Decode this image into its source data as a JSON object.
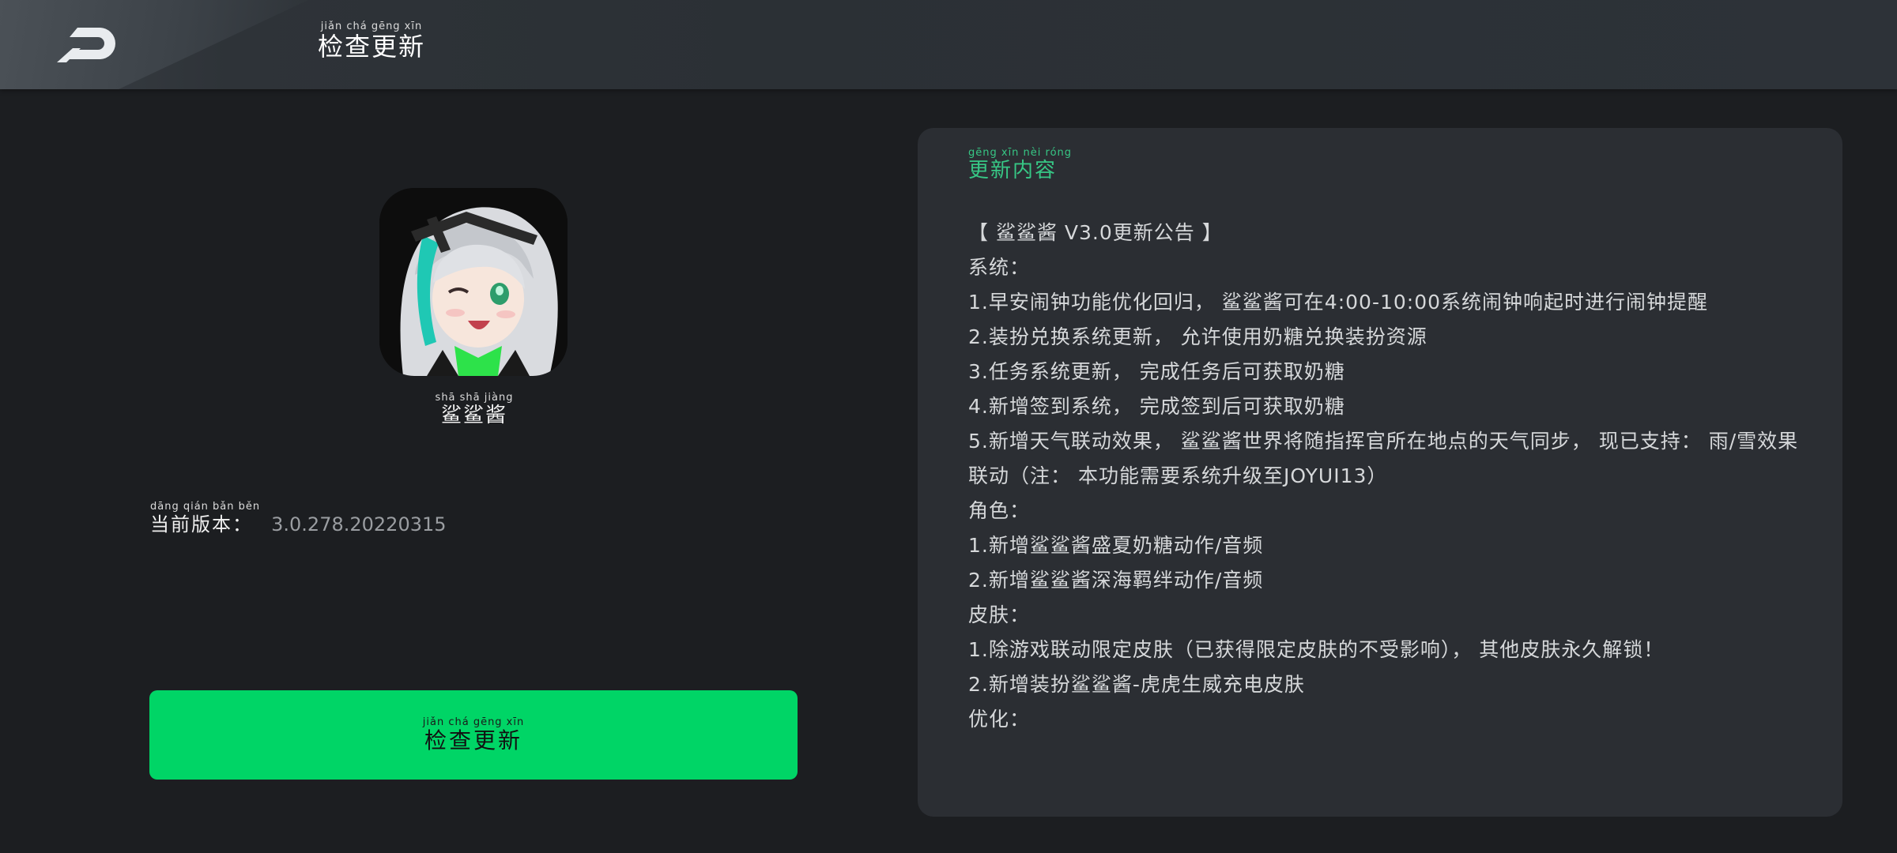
{
  "header": {
    "title_pinyin": "jiǎn chá gēng xīn",
    "title": "检查更新",
    "back_icon": "back-arrow-icon"
  },
  "app": {
    "name_pinyin": "shā shā jiàng",
    "name": "鲨鲨酱",
    "icon": "app-avatar-icon"
  },
  "version": {
    "label_pinyin": "dāng qián bǎn běn",
    "label": "当前版本：",
    "value": "3.0.278.20220315"
  },
  "check_button": {
    "label_pinyin": "jiǎn chá gēng xīn",
    "label": "检查更新"
  },
  "update_panel": {
    "title_pinyin": "gēng xīn nèi róng",
    "title": "更新内容",
    "lines": [
      "【 鲨鲨酱 V3.0更新公告 】",
      "系统：",
      "1.早安闹钟功能优化回归， 鲨鲨酱可在4:00-10:00系统闹钟响起时进行闹钟提醒",
      "2.装扮兑换系统更新， 允许使用奶糖兑换装扮资源",
      "3.任务系统更新， 完成任务后可获取奶糖",
      "4.新增签到系统， 完成签到后可获取奶糖",
      "5.新增天气联动效果， 鲨鲨酱世界将随指挥官所在地点的天气同步， 现已支持： 雨/雪效果联动（注： 本功能需要系统升级至JOYUI13）",
      "角色：",
      "1.新增鲨鲨酱盛夏奶糖动作/音频",
      "2.新增鲨鲨酱深海羁绊动作/音频",
      "皮肤：",
      "1.除游戏联动限定皮肤（已获得限定皮肤的不受影响）， 其他皮肤永久解锁！",
      "2.新增装扮鲨鲨酱-虎虎生威充电皮肤",
      "优化："
    ]
  },
  "colors": {
    "accent_green": "#00d566",
    "title_green": "#37c785",
    "background": "#1c1e21",
    "panel": "#2b2e33"
  }
}
